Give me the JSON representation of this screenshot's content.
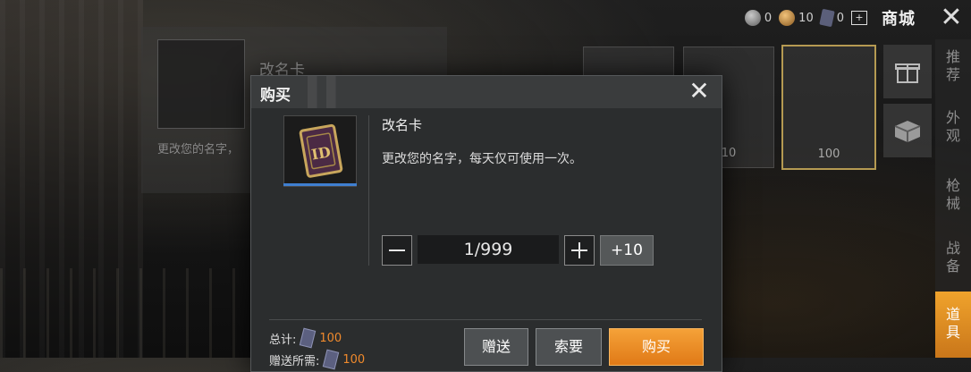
{
  "topbar": {
    "bp_count": "0",
    "uc_count": "10",
    "card_count": "0",
    "shop_title": "商城"
  },
  "sidenav": {
    "tabs": [
      {
        "label": "推荐"
      },
      {
        "label": "外观"
      },
      {
        "label": "枪械"
      },
      {
        "label": "战备"
      },
      {
        "label": "道具"
      }
    ],
    "active_tab": "道具"
  },
  "background": {
    "item_name": "改名卡",
    "item_desc": "更改您的名字，",
    "card_prices": [
      "10",
      "100"
    ]
  },
  "modal": {
    "title": "购买",
    "item_name": "改名卡",
    "item_desc": "更改您的名字，每天仅可使用一次。",
    "quantity": "1/999",
    "plus10_label": "+10",
    "total_label": "总计:",
    "total_price": "100",
    "gift_label": "赠送所需:",
    "gift_price": "100",
    "gift_button": "赠送",
    "request_button": "索要",
    "buy_button": "购买"
  },
  "colors": {
    "accent": "#e88a22",
    "price": "#f08a2c",
    "thumb_bar": "#3f7fd0"
  }
}
